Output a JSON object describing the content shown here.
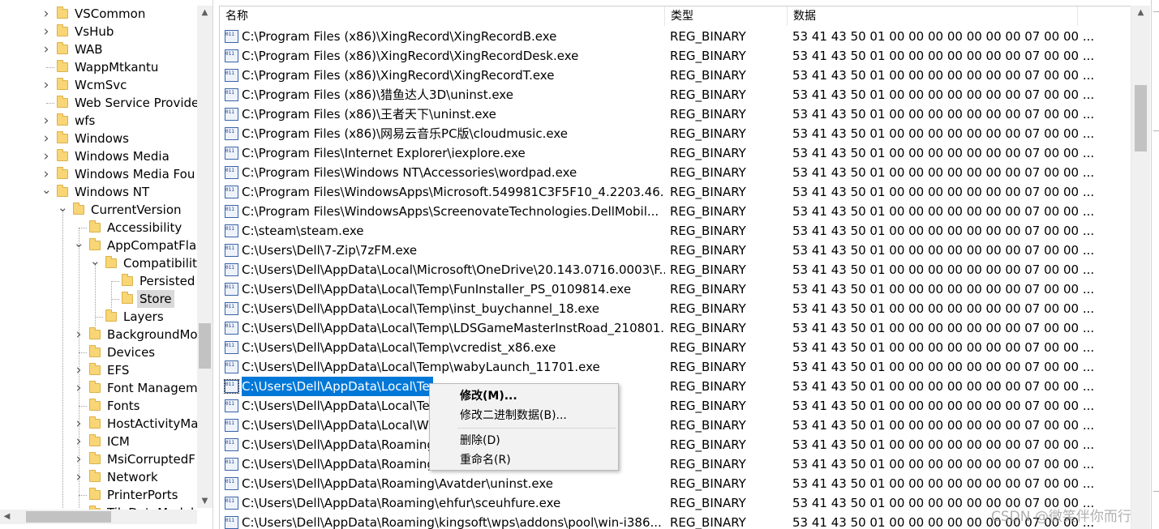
{
  "tree": {
    "items": [
      {
        "label": "VSCommon",
        "level": 0,
        "chevron": "right"
      },
      {
        "label": "VsHub",
        "level": 0,
        "chevron": "right"
      },
      {
        "label": "WAB",
        "level": 0,
        "chevron": "right"
      },
      {
        "label": "WappMtkantu",
        "level": 0,
        "chevron": "none"
      },
      {
        "label": "WcmSvc",
        "level": 0,
        "chevron": "right"
      },
      {
        "label": "Web Service Provide",
        "level": 0,
        "chevron": "none"
      },
      {
        "label": "wfs",
        "level": 0,
        "chevron": "right"
      },
      {
        "label": "Windows",
        "level": 0,
        "chevron": "right"
      },
      {
        "label": "Windows Media",
        "level": 0,
        "chevron": "right"
      },
      {
        "label": "Windows Media Fou",
        "level": 0,
        "chevron": "right"
      },
      {
        "label": "Windows NT",
        "level": 0,
        "chevron": "down"
      },
      {
        "label": "CurrentVersion",
        "level": 1,
        "chevron": "down"
      },
      {
        "label": "Accessibility",
        "level": 2,
        "chevron": "none"
      },
      {
        "label": "AppCompatFla",
        "level": 2,
        "chevron": "down"
      },
      {
        "label": "Compatibilit",
        "level": 3,
        "chevron": "down"
      },
      {
        "label": "Persisted",
        "level": 4,
        "chevron": "none"
      },
      {
        "label": "Store",
        "level": 4,
        "chevron": "none",
        "selected": true
      },
      {
        "label": "Layers",
        "level": 3,
        "chevron": "none"
      },
      {
        "label": "BackgroundMo",
        "level": 2,
        "chevron": "right"
      },
      {
        "label": "Devices",
        "level": 2,
        "chevron": "none"
      },
      {
        "label": "EFS",
        "level": 2,
        "chevron": "right"
      },
      {
        "label": "Font Managem",
        "level": 2,
        "chevron": "right"
      },
      {
        "label": "Fonts",
        "level": 2,
        "chevron": "none"
      },
      {
        "label": "HostActivityMa",
        "level": 2,
        "chevron": "right"
      },
      {
        "label": "ICM",
        "level": 2,
        "chevron": "right"
      },
      {
        "label": "MsiCorruptedF",
        "level": 2,
        "chevron": "right"
      },
      {
        "label": "Network",
        "level": 2,
        "chevron": "right"
      },
      {
        "label": "PrinterPorts",
        "level": 2,
        "chevron": "none"
      },
      {
        "label": "TileDataModel",
        "level": 2,
        "chevron": "right"
      }
    ]
  },
  "list": {
    "columns": {
      "name": "名称",
      "type": "类型",
      "data": "数据"
    },
    "icon_text": "011 110",
    "rows": [
      {
        "name": "C:\\Program Files (x86)\\XingRecord\\XingRecordB.exe",
        "type": "REG_BINARY",
        "data": "53 41 43 50 01 00 00 00 00 00 00 00 07 00 00 ..."
      },
      {
        "name": "C:\\Program Files (x86)\\XingRecord\\XingRecordDesk.exe",
        "type": "REG_BINARY",
        "data": "53 41 43 50 01 00 00 00 00 00 00 00 07 00 00 ..."
      },
      {
        "name": "C:\\Program Files (x86)\\XingRecord\\XingRecordT.exe",
        "type": "REG_BINARY",
        "data": "53 41 43 50 01 00 00 00 00 00 00 00 07 00 00 ..."
      },
      {
        "name": "C:\\Program Files (x86)\\猎鱼达人3D\\uninst.exe",
        "type": "REG_BINARY",
        "data": "53 41 43 50 01 00 00 00 00 00 00 00 07 00 00 ..."
      },
      {
        "name": "C:\\Program Files (x86)\\王者天下\\uninst.exe",
        "type": "REG_BINARY",
        "data": "53 41 43 50 01 00 00 00 00 00 00 00 07 00 00 ..."
      },
      {
        "name": "C:\\Program Files (x86)\\网易云音乐PC版\\cloudmusic.exe",
        "type": "REG_BINARY",
        "data": "53 41 43 50 01 00 00 00 00 00 00 00 07 00 00 ..."
      },
      {
        "name": "C:\\Program Files\\Internet Explorer\\iexplore.exe",
        "type": "REG_BINARY",
        "data": "53 41 43 50 01 00 00 00 00 00 00 00 07 00 00 ..."
      },
      {
        "name": "C:\\Program Files\\Windows NT\\Accessories\\wordpad.exe",
        "type": "REG_BINARY",
        "data": "53 41 43 50 01 00 00 00 00 00 00 00 07 00 00 ..."
      },
      {
        "name": "C:\\Program Files\\WindowsApps\\Microsoft.549981C3F5F10_4.2203.46...",
        "type": "REG_BINARY",
        "data": "53 41 43 50 01 00 00 00 00 00 00 00 07 00 00 ..."
      },
      {
        "name": "C:\\Program Files\\WindowsApps\\ScreenovateTechnologies.DellMobil...",
        "type": "REG_BINARY",
        "data": "53 41 43 50 01 00 00 00 00 00 00 00 07 00 00 ..."
      },
      {
        "name": "C:\\steam\\steam.exe",
        "type": "REG_BINARY",
        "data": "53 41 43 50 01 00 00 00 00 00 00 00 07 00 00 ..."
      },
      {
        "name": "C:\\Users\\Dell\\7-Zip\\7zFM.exe",
        "type": "REG_BINARY",
        "data": "53 41 43 50 01 00 00 00 00 00 00 00 07 00 00 ..."
      },
      {
        "name": "C:\\Users\\Dell\\AppData\\Local\\Microsoft\\OneDrive\\20.143.0716.0003\\F...",
        "type": "REG_BINARY",
        "data": "53 41 43 50 01 00 00 00 00 00 00 00 07 00 00 ..."
      },
      {
        "name": "C:\\Users\\Dell\\AppData\\Local\\Temp\\FunInstaller_PS_0109814.exe",
        "type": "REG_BINARY",
        "data": "53 41 43 50 01 00 00 00 00 00 00 00 07 00 00 ..."
      },
      {
        "name": "C:\\Users\\Dell\\AppData\\Local\\Temp\\inst_buychannel_18.exe",
        "type": "REG_BINARY",
        "data": "53 41 43 50 01 00 00 00 00 00 00 00 07 00 00 ..."
      },
      {
        "name": "C:\\Users\\Dell\\AppData\\Local\\Temp\\LDSGameMasterInstRoad_210801...",
        "type": "REG_BINARY",
        "data": "53 41 43 50 01 00 00 00 00 00 00 00 07 00 00 ..."
      },
      {
        "name": "C:\\Users\\Dell\\AppData\\Local\\Temp\\vcredist_x86.exe",
        "type": "REG_BINARY",
        "data": "53 41 43 50 01 00 00 00 00 00 00 00 07 00 00 ..."
      },
      {
        "name": "C:\\Users\\Dell\\AppData\\Local\\Temp\\wabyLaunch_11701.exe",
        "type": "REG_BINARY",
        "data": "53 41 43 50 01 00 00 00 00 00 00 00 07 00 00 ..."
      },
      {
        "name": "C:\\Users\\Dell\\AppData\\Local\\Te",
        "type": "REG_BINARY",
        "data": "53 41 43 50 01 00 00 00 00 00 00 00 07 00 00 ...",
        "selected": true
      },
      {
        "name": "C:\\Users\\Dell\\AppData\\Local\\Te                                   xe",
        "type": "REG_BINARY",
        "data": "53 41 43 50 01 00 00 00 00 00 00 00 07 00 00 ..."
      },
      {
        "name": "C:\\Users\\Dell\\AppData\\Local\\W                                   55)\\ti...",
        "type": "REG_BINARY",
        "data": "53 41 43 50 01 00 00 00 00 00 00 00 07 00 00 ..."
      },
      {
        "name": "C:\\Users\\Dell\\AppData\\Roaming",
        "type": "REG_BINARY",
        "data": "53 41 43 50 01 00 00 00 00 00 00 00 07 00 00 ..."
      },
      {
        "name": "C:\\Users\\Dell\\AppData\\Roaming",
        "type": "REG_BINARY",
        "data": "53 41 43 50 01 00 00 00 00 00 00 00 07 00 00 ..."
      },
      {
        "name": "C:\\Users\\Dell\\AppData\\Roaming\\Avatder\\uninst.exe",
        "type": "REG_BINARY",
        "data": "53 41 43 50 01 00 00 00 00 00 00 00 07 00 00 ..."
      },
      {
        "name": "C:\\Users\\Dell\\AppData\\Roaming\\ehfur\\sceuhfure.exe",
        "type": "REG_BINARY",
        "data": "53 41 43 50 01 00 00 00 00 00 00 00 07 00 00 ..."
      },
      {
        "name": "C:\\Users\\Dell\\AppData\\Roaming\\kingsoft\\wps\\addons\\pool\\win-i386...",
        "type": "REG_BINARY",
        "data": "53 41 43 50 01 00 00 00 00 00 00 00 07 00 00 ..."
      }
    ]
  },
  "context_menu": {
    "items": [
      {
        "label": "修改(M)...",
        "bold": true,
        "name": "menu-item-modify"
      },
      {
        "label": "修改二进制数据(B)...",
        "bold": false,
        "name": "menu-item-modify-binary"
      },
      {
        "separator": true
      },
      {
        "label": "删除(D)",
        "bold": false,
        "name": "menu-item-delete"
      },
      {
        "label": "重命名(R)",
        "bold": false,
        "name": "menu-item-rename"
      }
    ]
  },
  "watermark": "CSDN @微笑伴你而行",
  "colors": {
    "selection": "#0078d7",
    "folder": "#f8d575",
    "tree_selection": "#d9d9d9"
  }
}
